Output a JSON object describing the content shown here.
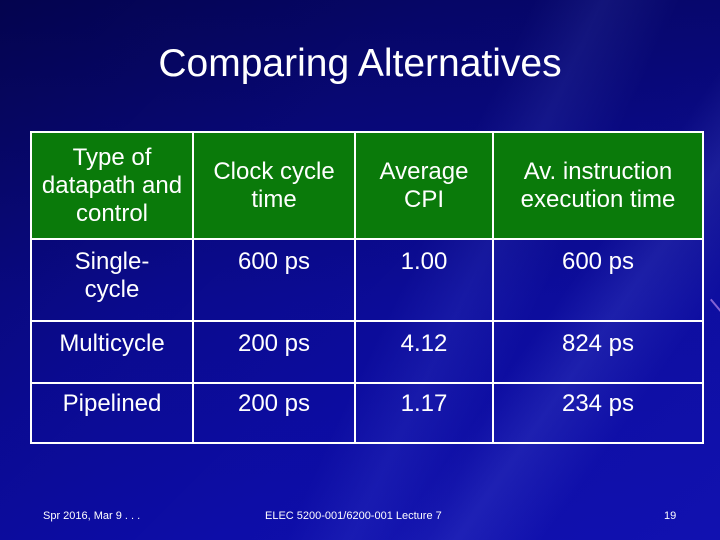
{
  "slide": {
    "title": "Comparing Alternatives",
    "background_color": "#0a0a8c",
    "header_color": "#0a7a0a"
  },
  "table": {
    "headers": [
      "Type of datapath and control",
      "Clock cycle time",
      "Average CPI",
      "Av. instruction execution time"
    ],
    "rows": [
      [
        "Single-cycle",
        "600 ps",
        "1.00",
        "600 ps"
      ],
      [
        "Multicycle",
        "200 ps",
        "4.12",
        "824 ps"
      ],
      [
        "Pipelined",
        "200 ps",
        "1.17",
        "234 ps"
      ]
    ]
  },
  "footer": {
    "date": "Spr 2016, Mar 9 . . .",
    "course": "ELEC 5200-001/6200-001 Lecture 7",
    "page_number": "19"
  }
}
